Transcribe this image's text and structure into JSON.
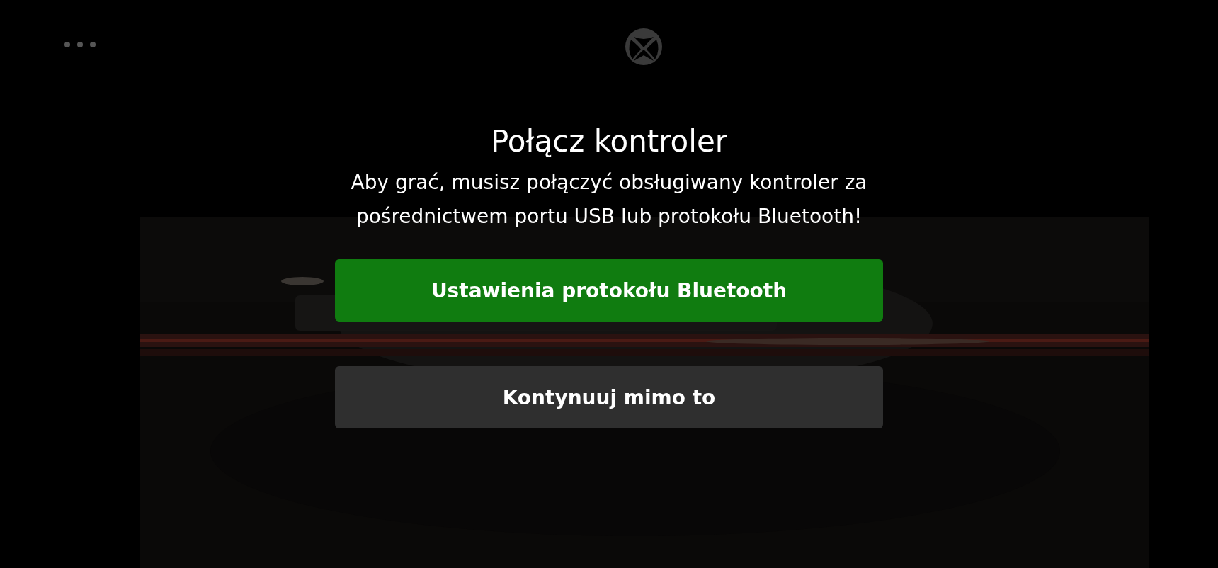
{
  "dialog": {
    "title": "Połącz kontroler",
    "message": "Aby grać, musisz połączyć obsługiwany kontroler za pośrednictwem portu USB lub protokołu Bluetooth!"
  },
  "buttons": [
    {
      "label": "Ustawienia protokołu Bluetooth",
      "kind": "primary"
    },
    {
      "label": "Kontynuuj mimo to",
      "kind": "secondary"
    }
  ]
}
